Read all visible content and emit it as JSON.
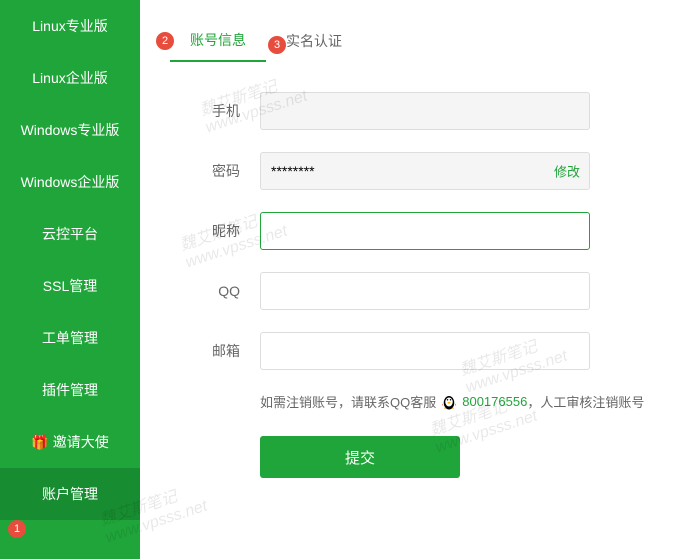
{
  "sidebar": {
    "items": [
      {
        "label": "Linux专业版"
      },
      {
        "label": "Linux企业版"
      },
      {
        "label": "Windows专业版"
      },
      {
        "label": "Windows企业版"
      },
      {
        "label": "云控平台"
      },
      {
        "label": "SSL管理"
      },
      {
        "label": "工单管理"
      },
      {
        "label": "插件管理"
      },
      {
        "label": "邀请大使",
        "gift": "🎁"
      },
      {
        "label": "账户管理"
      }
    ]
  },
  "badges": {
    "b1": "1",
    "b2": "2",
    "b3": "3"
  },
  "tabs": {
    "account_info": "账号信息",
    "real_name": "实名认证"
  },
  "form": {
    "phone_label": "手机",
    "phone_value": "",
    "password_label": "密码",
    "password_value": "********",
    "modify_link": "修改",
    "nickname_label": "昵称",
    "nickname_value": "",
    "qq_label": "QQ",
    "qq_value": "",
    "email_label": "邮箱",
    "email_value": ""
  },
  "note": {
    "prefix": "如需注销账号，请联系QQ客服",
    "qq_number": "800176556",
    "suffix": "，人工审核注销账号"
  },
  "submit": "提交",
  "watermark": {
    "line1": "魏艾斯笔记",
    "line2": "www.vpsss.net"
  }
}
